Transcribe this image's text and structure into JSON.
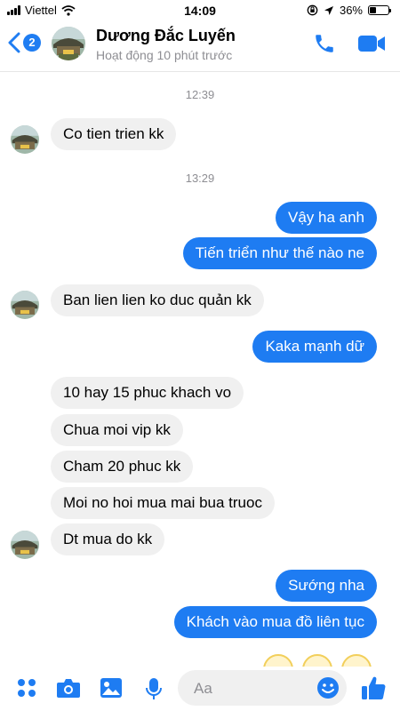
{
  "status_bar": {
    "carrier": "Viettel",
    "time": "14:09",
    "battery": "36%",
    "battery_level": 0.36,
    "icons": [
      "signal-icon",
      "wifi-icon",
      "orientation-lock-icon",
      "location-icon",
      "battery-icon"
    ]
  },
  "header": {
    "back_count": "2",
    "contact_name": "Dương Đắc Luyến",
    "activity": "Hoạt động 10 phút trước",
    "icons": [
      "back-chevron-icon",
      "phone-icon",
      "video-camera-icon"
    ]
  },
  "timestamps": [
    "12:39",
    "13:29"
  ],
  "messages": [
    {
      "side": "in",
      "text": "Co tien trien kk"
    },
    {
      "side": "out",
      "text": "Vậy ha anh"
    },
    {
      "side": "out",
      "text": "Tiến triển như thế nào ne"
    },
    {
      "side": "in",
      "text": "Ban lien lien ko duc quản kk"
    },
    {
      "side": "out",
      "text": "Kaka mạnh dữ"
    },
    {
      "side": "in",
      "text": "10 hay 15 phuc khach vo"
    },
    {
      "side": "in",
      "text": "Chua moi vip kk"
    },
    {
      "side": "in",
      "text": "Cham 20 phuc kk"
    },
    {
      "side": "in",
      "text": "Moi no hoi mua mai bua truoc"
    },
    {
      "side": "in",
      "text": "Dt mua do kk"
    },
    {
      "side": "out",
      "text": "Sướng nha"
    },
    {
      "side": "out",
      "text": "Khách vào mua đồ liên tục"
    }
  ],
  "composer": {
    "placeholder": "Aa",
    "icons": [
      "menu-dots-icon",
      "camera-icon",
      "image-icon",
      "microphone-icon",
      "emoji-icon",
      "thumbs-up-icon"
    ]
  },
  "colors": {
    "accent": "#1e7cf2",
    "incoming_bubble": "#f0f0f0",
    "muted_text": "#8e8e93"
  }
}
